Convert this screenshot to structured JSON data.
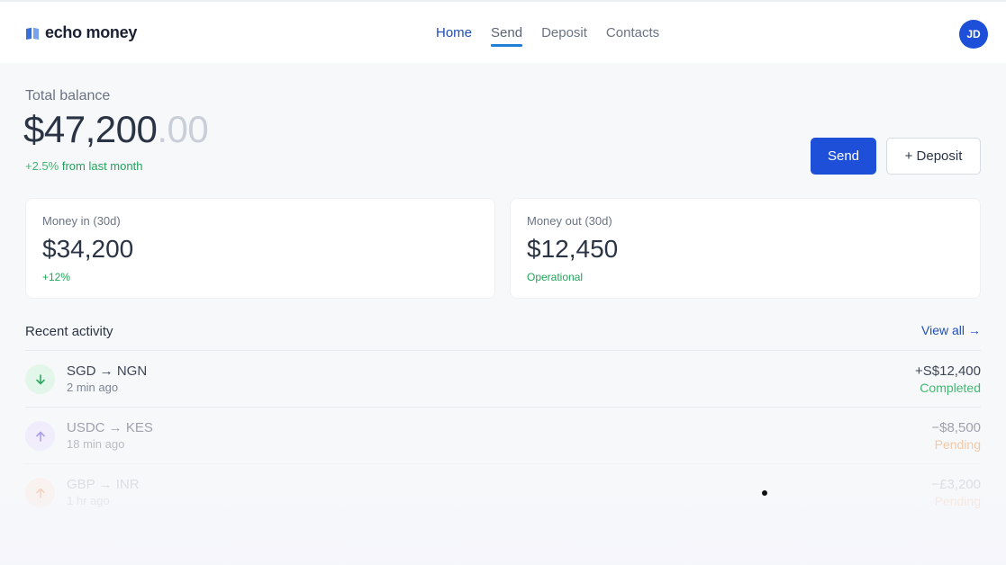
{
  "brand": {
    "name": "echo money",
    "logo_icon": "book-open-icon",
    "accent": "#1d4fd8"
  },
  "nav": {
    "items": [
      {
        "label": "Home"
      },
      {
        "label": "Send"
      },
      {
        "label": "Deposit"
      },
      {
        "label": "Contacts"
      }
    ],
    "active": "Send"
  },
  "user": {
    "initials": "JD"
  },
  "balance": {
    "label": "Total balance",
    "whole": "$47,200",
    "cents": ".00",
    "change_pct": "+2.5%",
    "change_text": " from last month"
  },
  "actions": {
    "send_label": "Send",
    "deposit_label": "+ Deposit"
  },
  "cards": {
    "money_in": {
      "label": "Money in (30d)",
      "value": "$34,200",
      "sub": "+12%"
    },
    "money_out": {
      "label": "Money out (30d)",
      "value": "$12,450",
      "sub": "Operational"
    }
  },
  "activity": {
    "title": "Recent activity",
    "view_all": "View all →",
    "rows": [
      {
        "pair": "SGD → NGN",
        "time": "2 min ago",
        "amount": "+S$12,400",
        "status": "Completed",
        "direction": "in",
        "icon": "arrow-down-icon"
      },
      {
        "pair": "USDC → KES",
        "time": "18 min ago",
        "amount": "−$8,500",
        "status": "Pending",
        "direction": "out",
        "icon": "arrow-up-icon"
      },
      {
        "pair": "GBP → INR",
        "time": "1 hr ago",
        "amount": "−£3,200",
        "status": "Pending",
        "direction": "out",
        "icon": "arrow-up-icon"
      }
    ]
  },
  "colors": {
    "positive": "#22a35a",
    "pending": "#f0b98a",
    "primary": "#1d4fd8"
  }
}
